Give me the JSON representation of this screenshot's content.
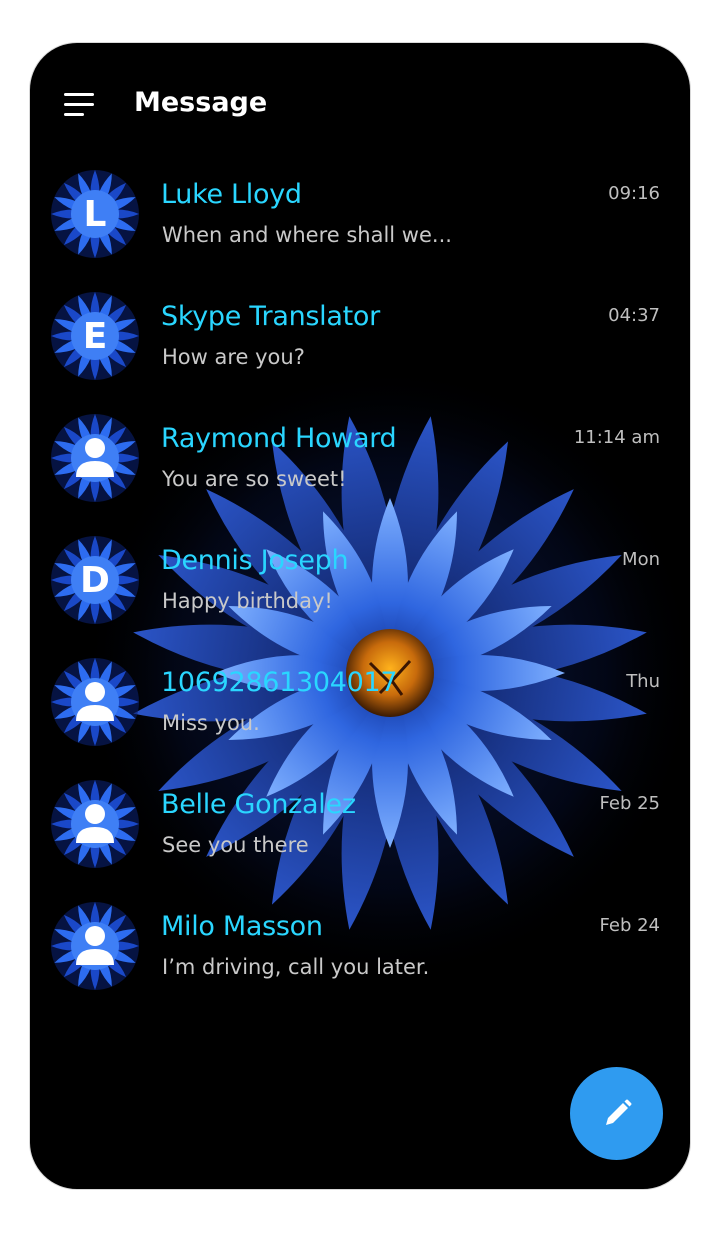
{
  "header": {
    "title": "Message",
    "menu_icon": "hamburger-menu-icon"
  },
  "colors": {
    "background": "#000000",
    "name": "#2ad6ff",
    "preview": "#c9c9c9",
    "time": "#bfbfbf",
    "fab": "#2f9bf0",
    "avatar_flower": "#1e5ed8"
  },
  "conversations": [
    {
      "avatar_letter": "L",
      "avatar_type": "letter",
      "name": "Luke Lloyd",
      "preview": "When and where shall we...",
      "time": "09:16"
    },
    {
      "avatar_letter": "E",
      "avatar_type": "letter",
      "name": "Skype Translator",
      "preview": "How are you?",
      "time": "04:37"
    },
    {
      "avatar_letter": "",
      "avatar_type": "person-icon",
      "name": "Raymond Howard",
      "preview": "You are so sweet!",
      "time": "11:14 am"
    },
    {
      "avatar_letter": "D",
      "avatar_type": "letter",
      "name": "Dennis Joseph",
      "preview": "Happy birthday!",
      "time": "Mon"
    },
    {
      "avatar_letter": "",
      "avatar_type": "person-icon",
      "name": "10692861304017",
      "preview": "Miss you.",
      "time": "Thu"
    },
    {
      "avatar_letter": "",
      "avatar_type": "person-icon",
      "name": "Belle Gonzalez",
      "preview": "See you there",
      "time": "Feb 25"
    },
    {
      "avatar_letter": "",
      "avatar_type": "person-icon",
      "name": "Milo Masson",
      "preview": "I’m driving, call you later.",
      "time": "Feb 24"
    }
  ],
  "fab": {
    "icon": "pencil-icon"
  }
}
